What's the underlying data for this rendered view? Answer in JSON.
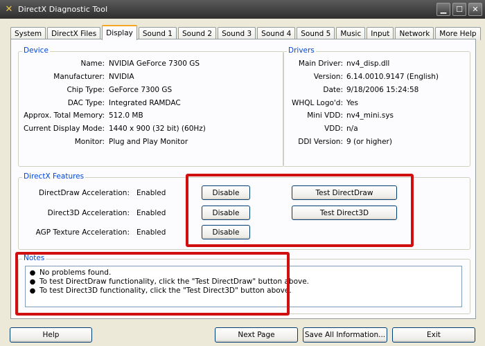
{
  "window": {
    "title": "DirectX Diagnostic Tool"
  },
  "tabs": [
    {
      "label": "System"
    },
    {
      "label": "DirectX Files"
    },
    {
      "label": "Display"
    },
    {
      "label": "Sound 1"
    },
    {
      "label": "Sound 2"
    },
    {
      "label": "Sound 3"
    },
    {
      "label": "Sound 4"
    },
    {
      "label": "Sound 5"
    },
    {
      "label": "Music"
    },
    {
      "label": "Input"
    },
    {
      "label": "Network"
    },
    {
      "label": "More Help"
    }
  ],
  "active_tab": "Display",
  "device": {
    "title": "Device",
    "rows": [
      {
        "label": "Name:",
        "value": "NVIDIA GeForce 7300 GS"
      },
      {
        "label": "Manufacturer:",
        "value": "NVIDIA"
      },
      {
        "label": "Chip Type:",
        "value": "GeForce 7300 GS"
      },
      {
        "label": "DAC Type:",
        "value": "Integrated RAMDAC"
      },
      {
        "label": "Approx. Total Memory:",
        "value": "512.0 MB"
      },
      {
        "label": "Current Display Mode:",
        "value": "1440 x 900 (32 bit) (60Hz)"
      },
      {
        "label": "Monitor:",
        "value": "Plug and Play Monitor"
      }
    ]
  },
  "drivers": {
    "title": "Drivers",
    "rows": [
      {
        "label": "Main Driver:",
        "value": "nv4_disp.dll"
      },
      {
        "label": "Version:",
        "value": "6.14.0010.9147 (English)"
      },
      {
        "label": "Date:",
        "value": "9/18/2006 15:24:58"
      },
      {
        "label": "WHQL Logo'd:",
        "value": "Yes"
      },
      {
        "label": "Mini VDD:",
        "value": "nv4_mini.sys"
      },
      {
        "label": "VDD:",
        "value": "n/a"
      },
      {
        "label": "DDI Version:",
        "value": "9 (or higher)"
      }
    ]
  },
  "features": {
    "title": "DirectX Features",
    "rows": [
      {
        "label": "DirectDraw Acceleration:",
        "value": "Enabled",
        "button": "Disable",
        "test_button": "Test DirectDraw"
      },
      {
        "label": "Direct3D Acceleration:",
        "value": "Enabled",
        "button": "Disable",
        "test_button": "Test Direct3D"
      },
      {
        "label": "AGP Texture Acceleration:",
        "value": "Enabled",
        "button": "Disable"
      }
    ]
  },
  "notes": {
    "title": "Notes",
    "items": [
      {
        "text": "No problems found."
      },
      {
        "text": "To test DirectDraw functionality, click the \"Test DirectDraw\" button above."
      },
      {
        "text": "To test Direct3D functionality, click the \"Test Direct3D\" button above."
      }
    ]
  },
  "footer": {
    "help": "Help",
    "next_page": "Next Page",
    "save_all": "Save All Information...",
    "exit": "Exit"
  },
  "colors": {
    "group_title": "#0046d5",
    "highlight": "#d01010",
    "active_tab_accent": "#f5a623"
  }
}
